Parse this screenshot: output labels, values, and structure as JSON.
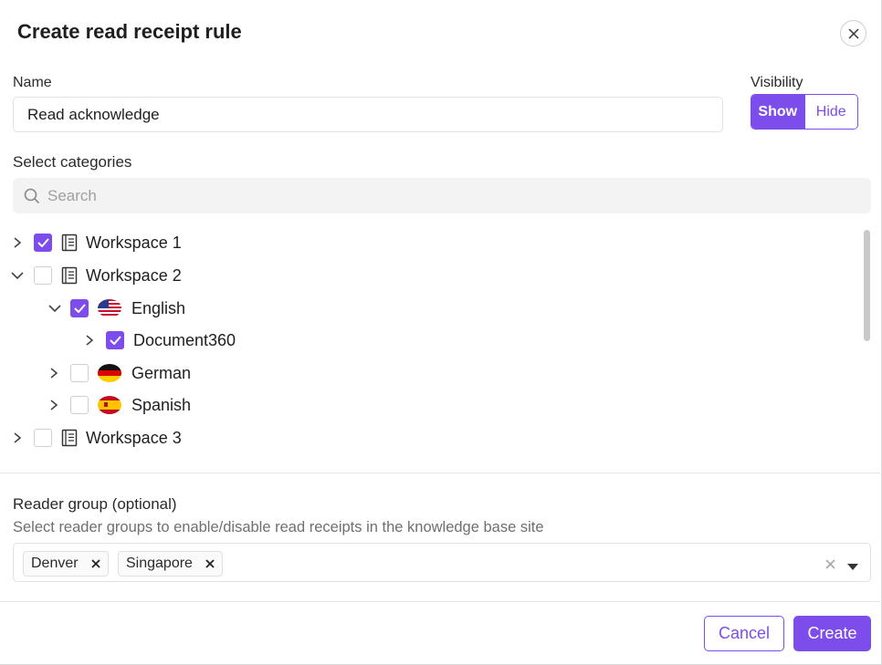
{
  "dialog": {
    "title": "Create read receipt rule",
    "close_icon": "close-icon"
  },
  "name_field": {
    "label": "Name",
    "value": "Read acknowledge"
  },
  "visibility": {
    "label": "Visibility",
    "options": [
      "Show",
      "Hide"
    ],
    "selected": "Show"
  },
  "categories": {
    "label": "Select categories",
    "search_placeholder": "Search",
    "tree": [
      {
        "label": "Workspace 1",
        "icon": "book-icon",
        "checked": true,
        "expanded": false,
        "level": 0
      },
      {
        "label": "Workspace 2",
        "icon": "book-icon",
        "checked": false,
        "expanded": true,
        "level": 0
      },
      {
        "label": "English",
        "icon": "us-flag-icon",
        "checked": true,
        "expanded": true,
        "level": 1
      },
      {
        "label": "Document360",
        "icon": "",
        "checked": true,
        "expanded": false,
        "level": 2
      },
      {
        "label": "German",
        "icon": "de-flag-icon",
        "checked": false,
        "expanded": false,
        "level": 1
      },
      {
        "label": "Spanish",
        "icon": "es-flag-icon",
        "checked": false,
        "expanded": false,
        "level": 1
      },
      {
        "label": "Workspace 3",
        "icon": "book-icon",
        "checked": false,
        "expanded": false,
        "level": 0
      }
    ]
  },
  "reader_group": {
    "label": "Reader group (optional)",
    "description": "Select reader groups to enable/disable read receipts in the knowledge base site",
    "chips": [
      "Denver",
      "Singapore"
    ]
  },
  "footer": {
    "cancel_label": "Cancel",
    "create_label": "Create"
  },
  "colors": {
    "accent": "#7c4dea"
  }
}
